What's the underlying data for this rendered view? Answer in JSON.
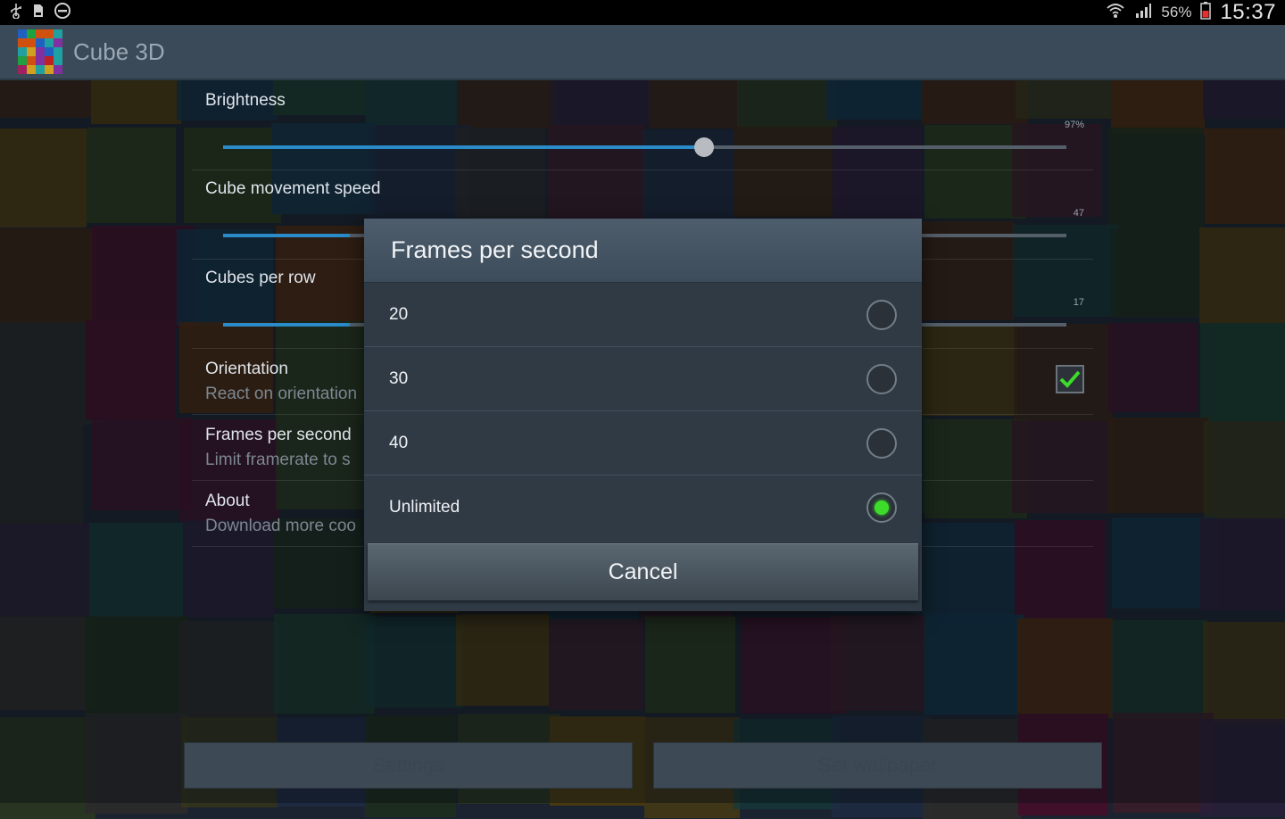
{
  "status_bar": {
    "left_icons": [
      "usb-icon",
      "sd-card-icon",
      "do-not-disturb-icon"
    ],
    "right_icons": [
      "wifi-icon",
      "signal-icon",
      "battery-icon"
    ],
    "battery": "56%",
    "time": "15:37"
  },
  "app": {
    "title": "Cube 3D",
    "logo_icon": "cube-3d-logo"
  },
  "settings": {
    "brightness": {
      "title": "Brightness",
      "value_label": "97%",
      "level": 0.57
    },
    "speed": {
      "title": "Cube movement speed",
      "value_label": "47",
      "level": 0.15
    },
    "cubes_per_row": {
      "title": "Cubes per row",
      "value_label": "17",
      "level": 0.15
    },
    "orientation": {
      "title": "Orientation",
      "summary": "React on orientation",
      "checked": true
    },
    "fps": {
      "title": "Frames per second",
      "summary": "Limit framerate to s"
    },
    "about": {
      "title": "About",
      "summary": "Download more coo"
    }
  },
  "bottom_buttons": {
    "settings": "Settings",
    "set_wallpaper": "Set wallpaper"
  },
  "dialog": {
    "title": "Frames per second",
    "options": [
      {
        "label": "20",
        "selected": false
      },
      {
        "label": "30",
        "selected": false
      },
      {
        "label": "40",
        "selected": false
      },
      {
        "label": "Unlimited",
        "selected": true
      }
    ],
    "cancel": "Cancel"
  },
  "colors": {
    "accent_blue": "#2a8bc8",
    "selected_green": "#3ddc2a",
    "actionbar": "#3a4a58",
    "dialog_bg": "#2f3a45"
  }
}
